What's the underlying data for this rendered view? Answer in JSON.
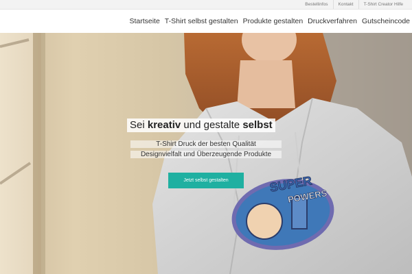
{
  "topbar": {
    "links": [
      "Bestellinfos",
      "Kontakt",
      "T-Shirt Creator Hilfe"
    ]
  },
  "nav": {
    "items": [
      "Startseite",
      "T-Shirt selbst gestalten",
      "Produkte gestalten",
      "Druckverfahren",
      "Gutscheincode"
    ]
  },
  "hero": {
    "headline_part1": "Sei ",
    "headline_bold1": "kreativ",
    "headline_part2": " und gestalte ",
    "headline_bold2": "selbst",
    "subline1": "T-Shirt Druck der besten Qualität",
    "subline2": "Designvielfalt und Überzeugende Produkte",
    "cta_label": "Jetzt selbst gestalten",
    "hoodie_print_line1": "SUPER",
    "hoodie_print_line2": "POWERS"
  },
  "colors": {
    "accent": "#1fb0a1"
  }
}
